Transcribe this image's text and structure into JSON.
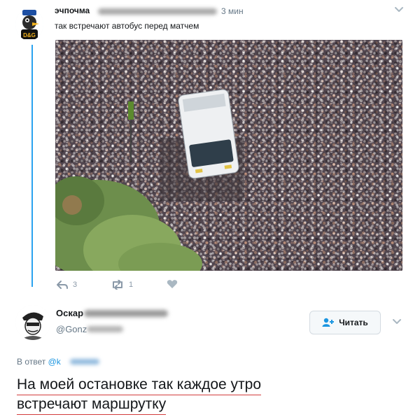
{
  "tweet1": {
    "author_name": "эчпочма",
    "time": "3 мин",
    "text": "так встречают автобус перед матчем",
    "avatar_label": "D&G",
    "photo_alt": "crowd surrounding team bus",
    "actions": {
      "replies": "3",
      "retweets": "1"
    }
  },
  "tweet2": {
    "author_name": "Оскар",
    "handle": "@Gonz",
    "follow_label": "Читать",
    "reply_to_prefix": "В ответ",
    "reply_to_handle": "@k",
    "text_line1": "На моей остановке так каждое утро",
    "text_line2": "встречают маршрутку"
  },
  "colors": {
    "thread": "#2aa3ef",
    "link": "#1b95e0",
    "underline": "#d23c3c",
    "muted": "#657786"
  },
  "icons": [
    "chevron-down-icon",
    "reply-icon",
    "retweet-icon",
    "like-icon",
    "follow-user-icon"
  ]
}
